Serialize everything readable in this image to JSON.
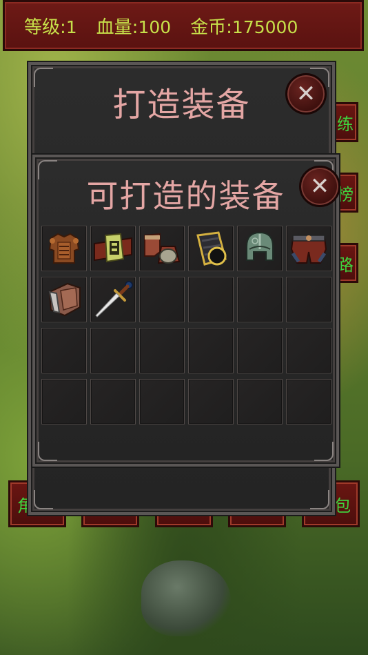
{
  "status_bar": {
    "level_label": "等级:",
    "level_value": "1",
    "hp_label": "血量:",
    "hp_value": "100",
    "gold_label": "金币:",
    "gold_value": "175000"
  },
  "side_buttons": [
    "练",
    "榜",
    "路"
  ],
  "bottom_buttons": [
    "角",
    "",
    "",
    "",
    "包"
  ],
  "forge_panel": {
    "title": "打造装备",
    "close_label": "✕"
  },
  "craftable_panel": {
    "title": "可打造的装备",
    "close_label": "✕",
    "slots": [
      {
        "item": "leather-chest-armor-icon"
      },
      {
        "item": "belt-icon"
      },
      {
        "item": "boots-icon"
      },
      {
        "item": "bracer-icon"
      },
      {
        "item": "helmet-icon"
      },
      {
        "item": "pants-icon"
      },
      {
        "item": "pauldron-icon"
      },
      {
        "item": "dagger-icon"
      },
      {
        "item": ""
      },
      {
        "item": ""
      },
      {
        "item": ""
      },
      {
        "item": ""
      },
      {
        "item": ""
      },
      {
        "item": ""
      },
      {
        "item": ""
      },
      {
        "item": ""
      },
      {
        "item": ""
      },
      {
        "item": ""
      },
      {
        "item": ""
      },
      {
        "item": ""
      },
      {
        "item": ""
      },
      {
        "item": ""
      },
      {
        "item": ""
      },
      {
        "item": ""
      }
    ]
  },
  "colors": {
    "status_text": "#c7e04a",
    "button_text": "#3fd43f",
    "title_text": "#e4a6a4",
    "bar_bg": "#5a1210"
  }
}
